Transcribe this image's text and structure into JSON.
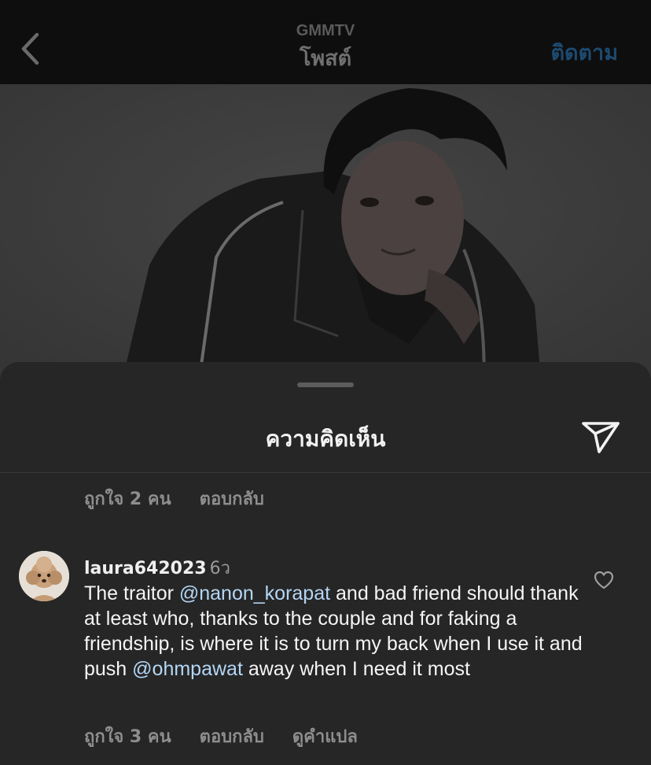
{
  "header": {
    "account": "GMMTV",
    "title": "โพสต์",
    "follow_label": "ติดตาม",
    "follow_color": "#1d4a70"
  },
  "post": {
    "image": "photo of a man in a black leather jacket on a grey background"
  },
  "sheet": {
    "title": "ความคิดเห็น"
  },
  "previous_comment": {
    "likes": "ถูกใจ 2 คน",
    "reply": "ตอบกลับ"
  },
  "comment": {
    "username": "laura642023",
    "time": "6ว",
    "segments": [
      {
        "text": "The traitor ",
        "mention": false
      },
      {
        "text": "@nanon_korapat",
        "mention": true
      },
      {
        "text": " and bad friend should thank at least who, thanks to the couple and for faking a friendship, is where it is to turn my back when I use it and push ",
        "mention": false
      },
      {
        "text": "@ohmpawat",
        "mention": true
      },
      {
        "text": " away when I need it most",
        "mention": false
      }
    ],
    "likes": "ถูกใจ 3 คน",
    "reply": "ตอบกลับ",
    "translate": "ดูคำแปล",
    "mention_color": "#b3d6f5"
  },
  "icons": {
    "back": "chevron-left-icon",
    "send": "paper-plane-icon",
    "like": "heart-icon",
    "avatar": "poodle-avatar"
  }
}
